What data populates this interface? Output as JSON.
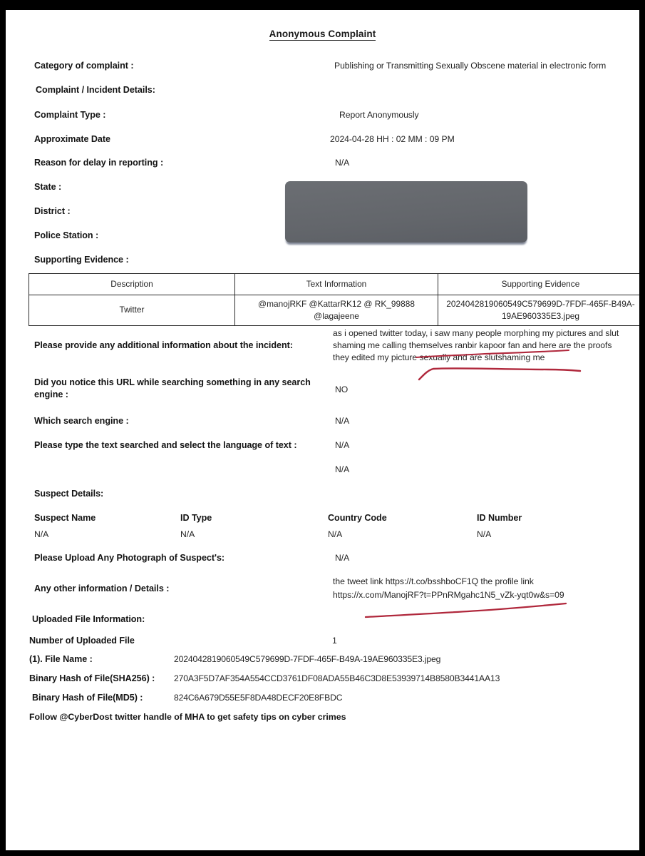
{
  "document": {
    "title": "Anonymous Complaint",
    "category_label": "Category of complaint :",
    "category_value": "Publishing or Transmitting Sexually Obscene material in electronic form",
    "incident_section_label": "Complaint / Incident Details:",
    "complaint_type_label": "Complaint Type :",
    "complaint_type_value": "Report Anonymously",
    "approximate_date_label": "Approximate Date",
    "approximate_date_value": "2024-04-28   HH : 02    MM : 09   PM",
    "reason_delay_label": "Reason for delay in reporting :",
    "reason_delay_value": "N/A",
    "state_label": "State :",
    "district_label": "District :",
    "police_station_label": "Police Station :",
    "supporting_evidence_label": "Supporting Evidence :"
  },
  "evidence_table": {
    "headers": [
      "Description",
      "Text Information",
      "Supporting Evidence"
    ],
    "rows": [
      {
        "description": "Twitter",
        "text_information": "@manojRKF @KattarRK12 @ RK_99888 @lagajeene",
        "supporting_evidence": "2024042819060549C579699D-7FDF-465F-B49A-19AE960335E3.jpeg"
      }
    ]
  },
  "incident_details": {
    "additional_info_label": "Please provide any additional information about the incident:",
    "additional_info_value": "as i opened twitter today, i saw many people morphing my pictures and slut shaming me calling themselves ranbir kapoor fan and here are the proofs they edited my picture sexually and are slutshaming me",
    "url_search_label": "Did you notice this URL while searching something in any search engine :",
    "url_search_value": "NO",
    "which_engine_label": "Which search engine :",
    "which_engine_value": "N/A",
    "text_searched_label": "Please type the text searched and select the language of text :",
    "text_searched_value": "N/A",
    "language_value": "N/A"
  },
  "suspect": {
    "section_label": "Suspect Details:",
    "headers": [
      "Suspect Name",
      "ID Type",
      "Country Code",
      "ID Number"
    ],
    "values": [
      "N/A",
      "N/A",
      "N/A",
      "N/A"
    ],
    "photograph_label": "Please Upload Any Photograph of Suspect's:",
    "photograph_value": "N/A"
  },
  "other_info": {
    "label": "Any other information / Details :",
    "line1": "the tweet link https://t.co/bsshboCF1Q the profile link",
    "line2": "https://x.com/ManojRF?t=PPnRMgahc1N5_vZk-yqt0w&s=09"
  },
  "uploaded_file": {
    "section_label": "Uploaded File Information:",
    "count_label": "Number of Uploaded File",
    "count_value": "1",
    "file_name_label": "(1). File Name :",
    "file_name_value": "2024042819060549C579699D-7FDF-465F-B49A-19AE960335E3.jpeg",
    "sha256_label": "Binary Hash of File(SHA256) :",
    "sha256_value": "270A3F5D7AF354A554CCD3761DF08ADA55B46C3D8E53939714B8580B3441AA13",
    "md5_label": "Binary Hash of File(MD5) :",
    "md5_value": "824C6A679D55E5F8DA48DECF20E8FBDC"
  },
  "footer": {
    "note": "Follow @CyberDost twitter handle of MHA to get safety tips on cyber crimes"
  },
  "annotations": {
    "ink_color": "#b0283c",
    "marks": [
      "underline-ranbir-kapoor-fan",
      "underline-slutshaming-line",
      "underline-profile-link"
    ]
  },
  "redaction": {
    "color": "#63666b",
    "covers": [
      "State",
      "District",
      "Police Station"
    ]
  }
}
